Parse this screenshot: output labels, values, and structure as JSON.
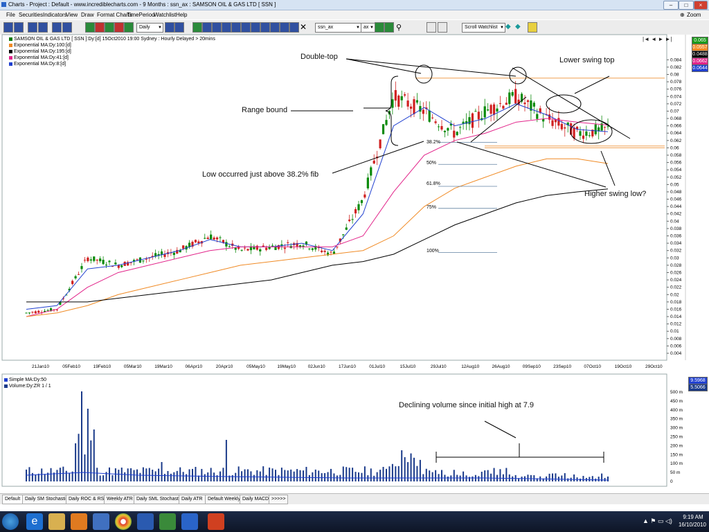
{
  "window": {
    "title": "Charts - Project : Default - www.incrediblecharts.com - 9 Months : ssn_ax : SAMSON OIL & GAS LTD  [ SSN ]",
    "min": "–",
    "max": "□",
    "close": "×"
  },
  "menu": [
    "File",
    "Securities",
    "Indicators",
    "View",
    "Draw",
    "Format Charts",
    "TimePeriod",
    "Watchlist",
    "Help"
  ],
  "zoom_label": "Zoom",
  "toolbar": {
    "period": "Daily",
    "ticker": "ssn_ax",
    "exchange": "ax",
    "watchlist": "Scroll Watchlist"
  },
  "legend": [
    {
      "text": "SAMSON OIL & GAS LTD [ SSN ]:Dy:[d]  15Oct2010 19:00 Sydney : Hourly Delayed > 20mins",
      "color": "#0a7a0a"
    },
    {
      "text": "Exponential MA:Dy:100:[d]",
      "color": "#f08a24"
    },
    {
      "text": "Exponential MA:Dy:195:[d]",
      "color": "#000000"
    },
    {
      "text": "Exponential MA:Dy:41:[d]",
      "color": "#e2248a"
    },
    {
      "text": "Exponential MA:Dy:8:[d]",
      "color": "#2040d0"
    }
  ],
  "right_boxes": [
    {
      "value": "0.065",
      "color": "#1a9a1a"
    },
    {
      "value": "0.0557",
      "color": "#f08a24"
    },
    {
      "value": "0.0488",
      "color": "#000000"
    },
    {
      "value": "0.0662",
      "color": "#e2248a"
    },
    {
      "value": "0.0644",
      "color": "#2040d0"
    }
  ],
  "y_ticks": [
    "0.084",
    "0.082",
    "0.08",
    "0.078",
    "0.076",
    "0.074",
    "0.072",
    "0.07",
    "0.068",
    "0.066",
    "0.064",
    "0.062",
    "0.06",
    "0.058",
    "0.056",
    "0.054",
    "0.052",
    "0.05",
    "0.048",
    "0.046",
    "0.044",
    "0.042",
    "0.04",
    "0.038",
    "0.036",
    "0.034",
    "0.032",
    "0.03",
    "0.028",
    "0.026",
    "0.024",
    "0.022",
    "0.02",
    "0.018",
    "0.016",
    "0.014",
    "0.012",
    "0.01",
    "0.008",
    "0.006",
    "0.004"
  ],
  "x_ticks": [
    "21Jan10",
    "05Feb10",
    "19Feb10",
    "05Mar10",
    "19Mar10",
    "06Apr10",
    "20Apr10",
    "05May10",
    "19May10",
    "02Jun10",
    "17Jun10",
    "01Jul10",
    "15Jul10",
    "29Jul10",
    "12Aug10",
    "26Aug10",
    "09Sep10",
    "23Sep10",
    "07Oct10",
    "19Oct10",
    "29Oct10"
  ],
  "fib_levels": [
    "38.2%",
    "50%",
    "61.8%",
    "75%",
    "100%"
  ],
  "annotations": {
    "double_top": "Double-top",
    "lower_swing_top": "Lower swing top",
    "range_bound": "Range bound",
    "low_fib": "Low occurred just above 38.2% fib",
    "higher_swing_low": "Higher swing low?",
    "volume_note": "Declining volume since initial high at 7.9"
  },
  "volume_panel": {
    "legend": [
      {
        "text": "Simple MA:Dy:50",
        "color": "#2040d0"
      },
      {
        "text": "Volume:Dy:ZR 1 / 1",
        "color": "#1a3a8a"
      }
    ],
    "right_boxes": [
      {
        "value": "9.5968 m",
        "color": "#2040d0"
      },
      {
        "value": "5.5066 m",
        "color": "#1a3a8a"
      }
    ],
    "y_ticks": [
      "500 m",
      "450 m",
      "400 m",
      "350 m",
      "300 m",
      "250 m",
      "200 m",
      "150 m",
      "100 m",
      "50 m",
      "0"
    ]
  },
  "bottom_tabs": [
    "Default",
    "Daily SM Stochastic",
    "Daily ROC & RSI",
    "Weekly ATR",
    "Daily SML Stochastic",
    "Daily ATR",
    "Default Weekly",
    "Daily MACD",
    ">>>>>"
  ],
  "taskbar": {
    "time": "9:19 AM",
    "date": "16/10/2010"
  },
  "chart_data": {
    "type": "candlestick",
    "ylim": [
      0.004,
      0.085
    ],
    "x": [
      "21Jan10",
      "05Feb10",
      "19Feb10",
      "05Mar10",
      "19Mar10",
      "06Apr10",
      "20Apr10",
      "05May10",
      "19May10",
      "02Jun10",
      "17Jun10",
      "01Jul10",
      "15Jul10",
      "29Jul10",
      "12Aug10",
      "26Aug10",
      "09Sep10",
      "23Sep10",
      "07Oct10",
      "15Oct10"
    ],
    "series": [
      {
        "values": [
          0.015,
          0.016,
          0.03,
          0.028,
          0.03,
          0.032,
          0.036,
          0.032,
          0.033,
          0.034,
          0.031,
          0.046,
          0.074,
          0.07,
          0.064,
          0.07,
          0.074,
          0.068,
          0.064,
          0.065
        ]
      },
      {
        "name": "Exponential MA:Dy:8:[d]",
        "values": [
          0.016,
          0.017,
          0.027,
          0.028,
          0.03,
          0.032,
          0.035,
          0.033,
          0.033,
          0.034,
          0.032,
          0.042,
          0.066,
          0.071,
          0.066,
          0.068,
          0.072,
          0.069,
          0.065,
          0.0644
        ]
      },
      {
        "name": "Exponential MA:Dy:41:[d]",
        "values": [
          0.014,
          0.016,
          0.022,
          0.026,
          0.028,
          0.03,
          0.032,
          0.033,
          0.033,
          0.033,
          0.033,
          0.036,
          0.048,
          0.058,
          0.062,
          0.064,
          0.067,
          0.068,
          0.067,
          0.0662
        ]
      },
      {
        "name": "Exponential MA:Dy:100:[d]",
        "values": [
          0.014,
          0.015,
          0.017,
          0.02,
          0.022,
          0.024,
          0.026,
          0.028,
          0.029,
          0.03,
          0.031,
          0.032,
          0.036,
          0.044,
          0.049,
          0.052,
          0.055,
          0.057,
          0.057,
          0.0557
        ]
      },
      {
        "name": "Exponential MA:Dy:195:[d]",
        "values": [
          0.018,
          0.018,
          0.018,
          0.019,
          0.02,
          0.021,
          0.022,
          0.023,
          0.024,
          0.026,
          0.028,
          0.029,
          0.031,
          0.035,
          0.039,
          0.042,
          0.045,
          0.047,
          0.048,
          0.0488
        ]
      }
    ]
  }
}
